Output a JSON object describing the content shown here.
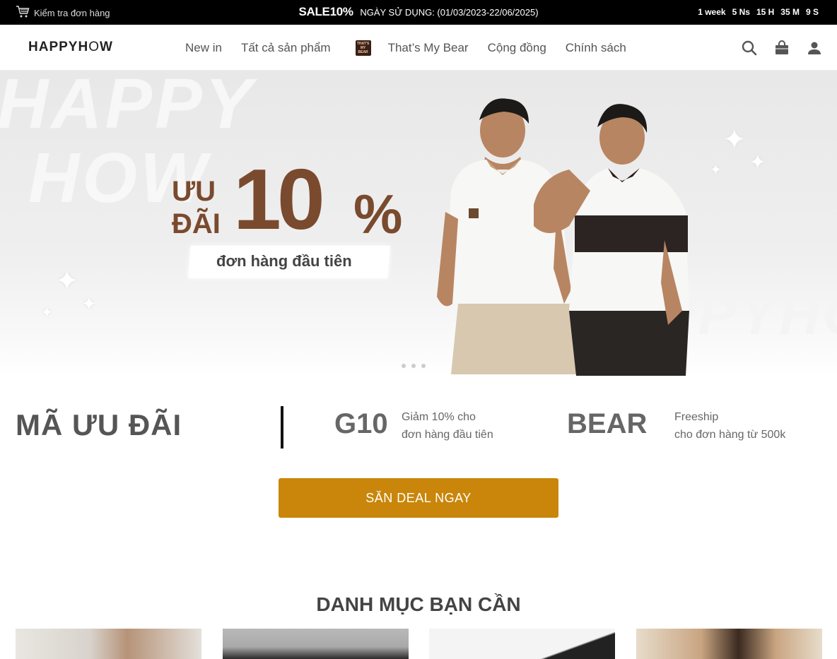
{
  "topbar": {
    "check_order": "Kiểm tra đơn hàng",
    "sale_label": "SALE10%",
    "usage_text": "NGÀY SỬ DỤNG: (01/03/2023-22/06/2025)",
    "countdown": [
      "1 week",
      "5 Ns",
      "15 H",
      "35 M",
      "9 S"
    ]
  },
  "header": {
    "logo_bold": "HAPPYH",
    "logo_light": "O",
    "logo_end": "W",
    "nav": [
      "New in",
      "Tất cả sản phẩm",
      "That’s My Bear",
      "Cộng đồng",
      "Chính sách"
    ],
    "bear_badge": "THAT'S MY BEAR"
  },
  "hero": {
    "watermark_1": "HAPPY",
    "watermark_2": "HOW",
    "watermark_3": "PPYHO",
    "uu": "ƯU",
    "dai": "ĐÃI",
    "big_number": "10",
    "percent": "%",
    "subtitle": "đơn hàng đầu tiên"
  },
  "codes": {
    "title": "MÃ ƯU ĐÃI",
    "code1": "G10",
    "code1_desc_1": "Giảm 10% cho",
    "code1_desc_2": "đơn hàng đầu tiên",
    "code2": "BEAR",
    "code2_desc_1": "Freeship",
    "code2_desc_2": "cho đơn hàng từ 500k"
  },
  "cta_label": "SĂN DEAL NGAY",
  "section_title": "DANH MỤC BẠN CẦN",
  "colors": {
    "accent": "#c9860a",
    "brown": "#7a4a2e",
    "topbar": "#000000"
  }
}
